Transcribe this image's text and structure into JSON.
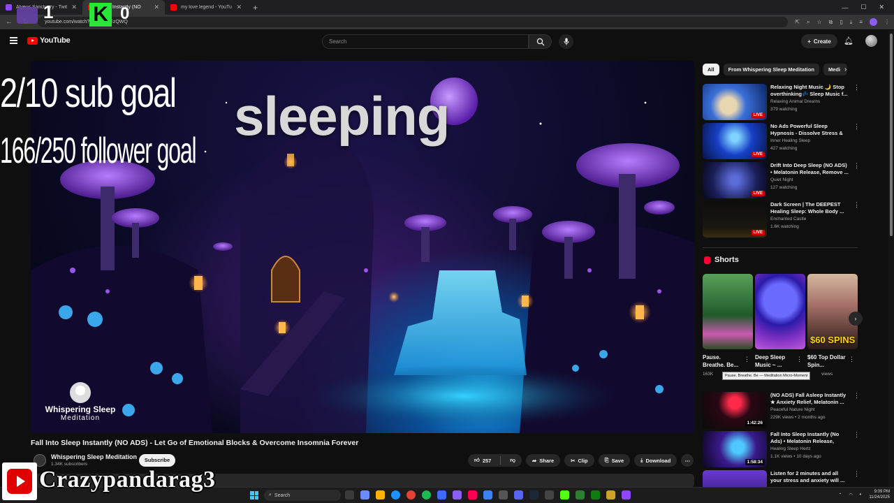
{
  "browser": {
    "tabs": [
      {
        "label": "Alyeus Sanctuary - Twitch",
        "favicon_color": "#9146ff"
      },
      {
        "label": "Sleep Instantly (NO",
        "favicon_color": "#ff0000"
      },
      {
        "label": "my love legend - YouTube",
        "favicon_color": "#ff0000"
      }
    ],
    "url": "youtube.com/watch?v=MBN...EzQWQ"
  },
  "overlay": {
    "counter_left": "1",
    "k_label": "K",
    "counter_right": "0",
    "sub_goal": "2/10 sub goal",
    "follower_goal": "166/250 follower goal",
    "streamer_name": "Crazypandarag3"
  },
  "header": {
    "logo_text": "YouTube",
    "search_placeholder": "Search",
    "create_label": "Create"
  },
  "player": {
    "overlay_text": "sleeping",
    "watermark_line1": "Whispering Sleep",
    "watermark_line2": "Meditation"
  },
  "video": {
    "title": "Fall Into Sleep Instantly (NO ADS) - Let Go of Emotional Blocks & Overcome Insomnia Forever",
    "channel": "Whispering Sleep Meditation",
    "subscribers": "1.34K subscribers",
    "subscribe_label": "Subscribe",
    "likes": "257",
    "share_label": "Share",
    "clip_label": "Clip",
    "save_label": "Save",
    "download_label": "Download"
  },
  "chips": [
    "All",
    "From Whispering Sleep Meditation",
    "Medi"
  ],
  "recommendations": [
    {
      "title": "Relaxing Night Music 🌙 Stop overthinking💤 Sleep Music f...",
      "channel": "Relaxing Animal Dreams",
      "meta": "379 watching",
      "badge": "LIVE"
    },
    {
      "title": "No Ads Powerful Sleep Hypnosis - Dissolve Stress & ...",
      "channel": "Inner Healing Sleep",
      "meta": "427 watching",
      "badge": "LIVE"
    },
    {
      "title": "Drift Into Deep Sleep (NO ADS) • Melatonin Release, Remove ...",
      "channel": "Quiet Night",
      "meta": "127 watching",
      "badge": "LIVE"
    },
    {
      "title": "Dark Screen | The DEEPEST Healing Sleep: Whole Body ...",
      "channel": "Enchanted Castle",
      "meta": "1.6K watching",
      "badge": "LIVE"
    }
  ],
  "shorts": {
    "heading": "Shorts",
    "items": [
      {
        "title": "Pause. Breathe. Be...",
        "views": "163K"
      },
      {
        "title": "Deep Sleep Music ~ ...",
        "views": ""
      },
      {
        "title": "$60 Top Dollar Spin...",
        "views": "views",
        "thumb_text": "$60 SPINS"
      }
    ],
    "tooltip": "Pause. Breathe. Be — Meditation Micro-Moment"
  },
  "recommendations2": [
    {
      "title": "(NO ADS) Fall Asleep Instantly ★ Anxiety Relief, Melatonin ...",
      "channel": "Peaceful Nature Night",
      "meta": "229K views • 2 months ago",
      "duration": "1:42:26"
    },
    {
      "title": "Fall Into Sleep Instantly (No Ads) • Melatonin Release, Stop...",
      "channel": "Healing Sleep Hertz",
      "meta": "1.1K views • 10 days ago",
      "duration": "1:58:34"
    },
    {
      "title": "Listen for 2 minutes and all your stress and anxiety will ...",
      "channel": "",
      "meta": "",
      "duration": ""
    }
  ],
  "taskbar": {
    "search_label": "Search",
    "time": "9:09 PM",
    "date": "11/24/2025"
  },
  "colors": {
    "accent_red": "#ff0000",
    "background": "#0f0f0f",
    "twitch_purple": "#9146ff",
    "overlay_green": "#27e837"
  }
}
